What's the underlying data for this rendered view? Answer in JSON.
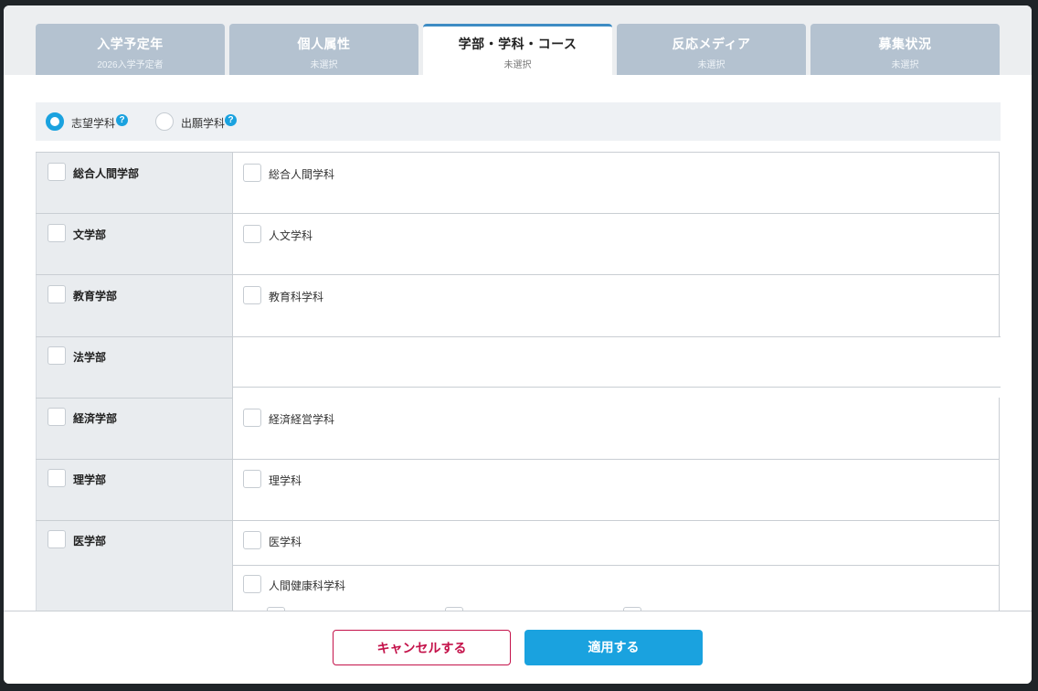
{
  "tabs": [
    {
      "label": "入学予定年",
      "sub": "2026入学予定者"
    },
    {
      "label": "個人属性",
      "sub": "未選択"
    },
    {
      "label": "学部・学科・コース",
      "sub": "未選択"
    },
    {
      "label": "反応メディア",
      "sub": "未選択"
    },
    {
      "label": "募集状況",
      "sub": "未選択"
    }
  ],
  "active_tab": 2,
  "radio": {
    "option1": "志望学科",
    "option2": "出願学科",
    "selected": "志望学科",
    "help_glyph": "?"
  },
  "faculties": [
    {
      "name": "総合人間学部",
      "departments": [
        "総合人間学科"
      ]
    },
    {
      "name": "文学部",
      "departments": [
        "人文学科"
      ]
    },
    {
      "name": "教育学部",
      "departments": [
        "教育科学科"
      ]
    },
    {
      "name": "法学部",
      "departments": []
    },
    {
      "name": "経済学部",
      "departments": [
        "経済経営学科"
      ]
    },
    {
      "name": "理学部",
      "departments": [
        "理学科"
      ]
    },
    {
      "name": "医学部",
      "departments": [
        "医学科",
        "人間健康科学科"
      ]
    }
  ],
  "footer": {
    "cancel_label": "キャンセルする",
    "apply_label": "適用する"
  },
  "colors": {
    "accent": "#1aa2df",
    "cancel": "#c4124a",
    "tab_inactive": "#b4c2d0"
  }
}
